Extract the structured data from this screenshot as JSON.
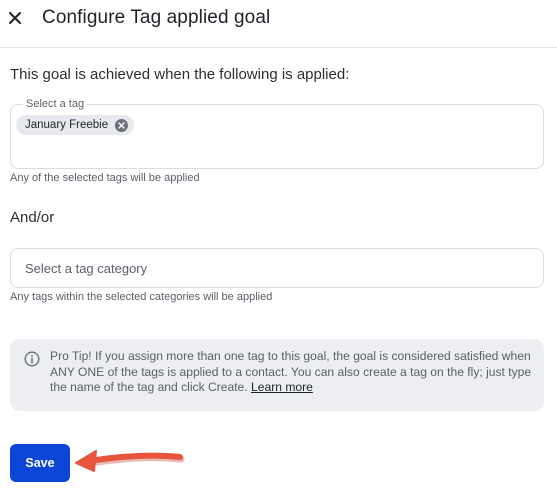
{
  "header": {
    "title": "Configure Tag applied goal",
    "close_icon": "close-icon"
  },
  "form": {
    "intro": "This goal is achieved when the following is applied:",
    "tag_select": {
      "label": "Select a tag",
      "selected_tags": [
        "January Freebie"
      ],
      "helper": "Any of the selected tags will be applied"
    },
    "andor": "And/or",
    "category_select": {
      "placeholder": "Select a tag category",
      "helper": "Any tags within the selected categories will be applied"
    },
    "tip": {
      "icon": "info-icon",
      "text": "Pro Tip! If you assign more than one tag to this goal, the goal is considered satisfied when ANY ONE of the tags is applied to a contact. You can also create a tag on the fly; just type the name of the tag and click Create.",
      "link": "Learn more"
    },
    "save_label": "Save"
  },
  "annotation": {
    "icon": "pointer-arrow",
    "color": "#e8553f"
  },
  "colors": {
    "primary": "#0b46d6",
    "tip_background": "#eceef1",
    "chip_background": "#e7e9ee"
  }
}
